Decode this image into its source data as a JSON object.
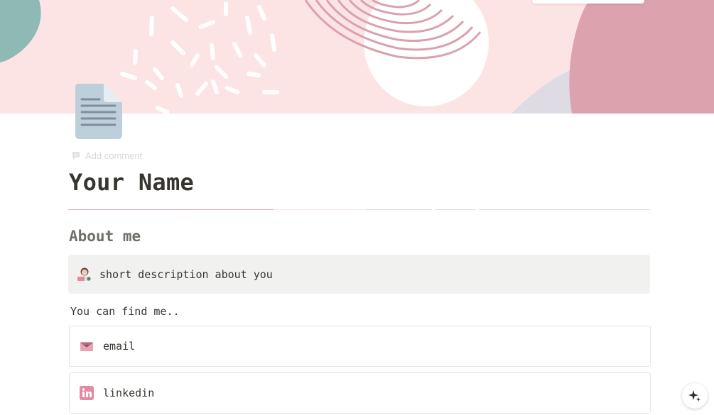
{
  "page": {
    "title": "Your Name",
    "icon": "document-icon",
    "add_comment_label": "Add comment"
  },
  "about": {
    "heading": "About me",
    "callout_icon": "person-with-laptop-icon",
    "callout_text": "short description about you"
  },
  "contact": {
    "intro": "You can find me..",
    "links": [
      {
        "icon": "envelope-icon",
        "label": "email"
      },
      {
        "icon": "linkedin-icon",
        "label": "linkedin"
      }
    ]
  },
  "colors": {
    "cover_background": "#fde4e4",
    "callout_background": "#f1f1ef",
    "text": "#37352f",
    "heading_gray": "#6f6e69",
    "accent_pink": "#d9a2ad"
  }
}
